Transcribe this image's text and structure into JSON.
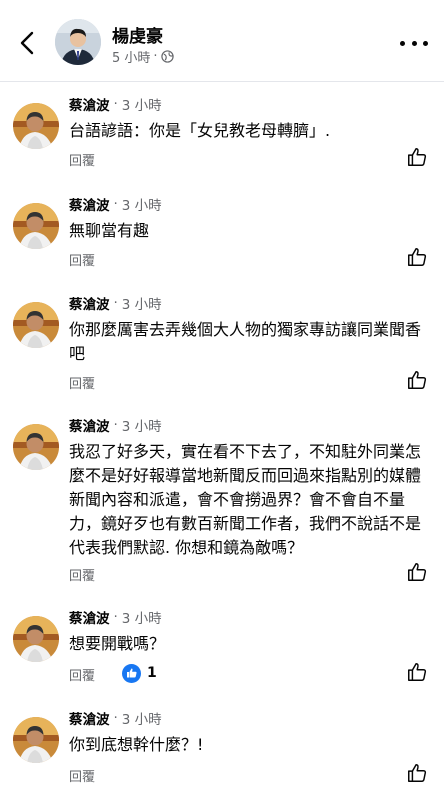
{
  "header": {
    "name": "楊虔豪",
    "time": "5 小時",
    "separator": "·",
    "privacy_icon": "globe-icon"
  },
  "comments": [
    {
      "author": "蔡滄波",
      "time": "3 小時",
      "text": "台語諺語：你是「女兒教老母轉臍」.",
      "reply_label": "回覆"
    },
    {
      "author": "蔡滄波",
      "time": "3 小時",
      "text": "無聊當有趣",
      "reply_label": "回覆"
    },
    {
      "author": "蔡滄波",
      "time": "3 小時",
      "text": "你那麼厲害去弄幾個大人物的獨家專訪讓同業聞香吧",
      "reply_label": "回覆"
    },
    {
      "author": "蔡滄波",
      "time": "3 小時",
      "text": "我忍了好多天，實在看不下去了，不知駐外同業怎麼不是好好報導當地新聞反而回過來指點別的媒體新聞內容和派遣，會不會撈過界？會不會自不量力，鏡好歹也有數百新聞工作者，我們不說話不是代表我們默認. 你想和鏡為敵嗎？",
      "reply_label": "回覆"
    },
    {
      "author": "蔡滄波",
      "time": "3 小時",
      "text": "想要開戰嗎？",
      "reply_label": "回覆",
      "reaction_count": "1"
    },
    {
      "author": "蔡滄波",
      "time": "3 小時",
      "text": "你到底想幹什麼？!",
      "reply_label": "回覆"
    }
  ]
}
